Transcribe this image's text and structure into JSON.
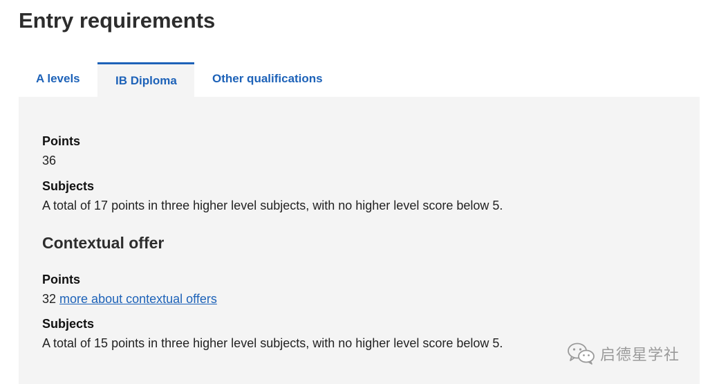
{
  "page": {
    "title": "Entry requirements"
  },
  "tabs": [
    {
      "label": "A levels",
      "active": false
    },
    {
      "label": "IB Diploma",
      "active": true
    },
    {
      "label": "Other qualifications",
      "active": false
    }
  ],
  "ib": {
    "points_label": "Points",
    "points_value": "36",
    "subjects_label": "Subjects",
    "subjects_value": "A total of 17 points in three higher level subjects, with no higher level score below 5."
  },
  "contextual": {
    "heading": "Contextual offer",
    "points_label": "Points",
    "points_value": "32",
    "points_link": "more about contextual offers",
    "subjects_label": "Subjects",
    "subjects_value": "A total of 15 points in three higher level subjects, with no higher level score below 5."
  },
  "watermark": {
    "icon": "wechat-icon",
    "text": "启德星学社"
  },
  "colors": {
    "accent": "#1d62b8",
    "panel_bg": "#f4f4f4",
    "heading": "#2d2d2d"
  }
}
